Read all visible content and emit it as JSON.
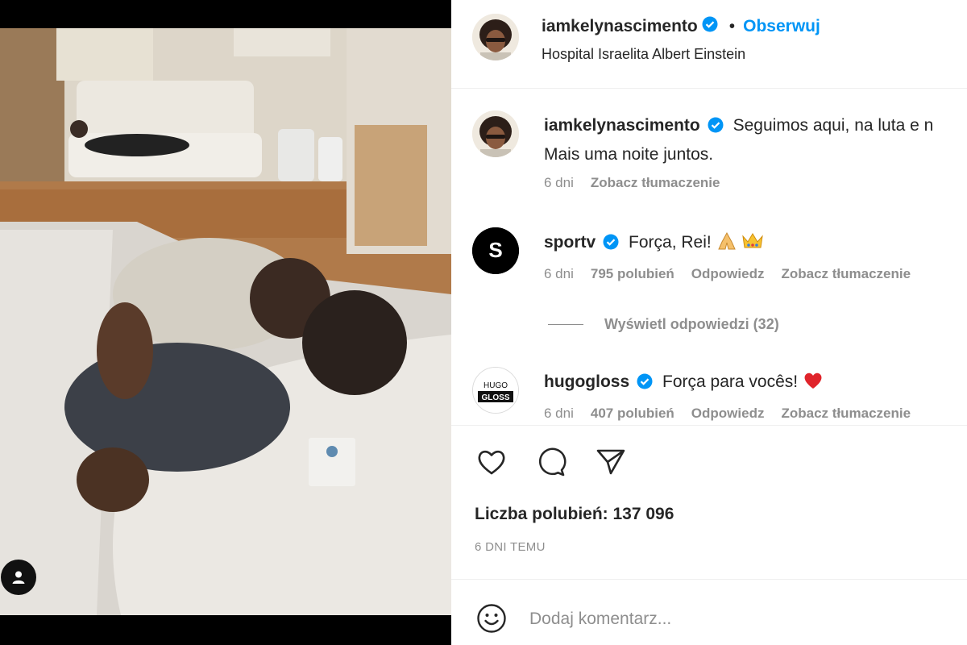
{
  "colors": {
    "accent": "#0095f6",
    "text": "#262626",
    "muted": "#8e8e8e",
    "verified": "#0095f6"
  },
  "post": {
    "username": "iamkelynascimento",
    "follow_label": "Obserwuj",
    "separator": "•",
    "location": "Hospital Israelita Albert Einstein",
    "photo": "hospital-room-photo",
    "tag_icon": "user-tag-icon"
  },
  "comments": [
    {
      "username": "iamkelynascimento",
      "verified": true,
      "text": "Seguimos aqui, na luta e n",
      "text_line2": "Mais uma noite juntos.",
      "time": "6 dni",
      "translate": "Zobacz tłumaczenie"
    },
    {
      "username": "sportv",
      "verified": true,
      "text": "Força, Rei!",
      "emojis": [
        "folded-hands-icon",
        "crown-icon"
      ],
      "time": "6 dni",
      "likes": "795 polubień",
      "reply": "Odpowiedz",
      "translate": "Zobacz tłumaczenie",
      "view_replies": "Wyświetl odpowiedzi (32)"
    },
    {
      "username": "hugogloss",
      "verified": true,
      "text": "Força para vocês!",
      "emojis": [
        "red-heart-icon"
      ],
      "time": "6 dni",
      "likes": "407 polubień",
      "reply": "Odpowiedz",
      "translate": "Zobacz tłumaczenie",
      "avatar_text_top": "HUGO",
      "avatar_text_bottom": "GLOSS"
    }
  ],
  "actions": [
    "heart-icon",
    "comment-icon",
    "share-icon"
  ],
  "likes_text": "Liczba polubień: 137 096",
  "timestamp": "6 DNI TEMU",
  "add_comment": {
    "placeholder": "Dodaj komentarz..."
  }
}
